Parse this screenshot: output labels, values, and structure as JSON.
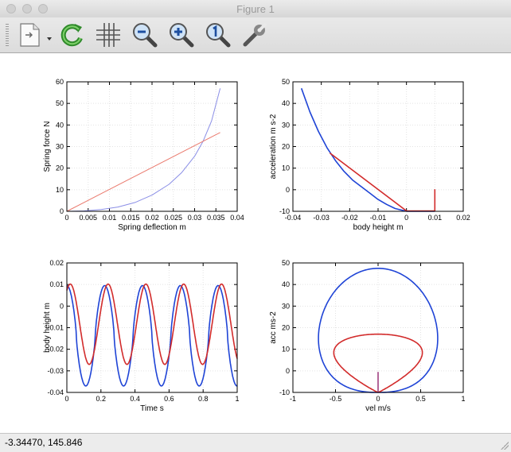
{
  "window": {
    "title": "Figure 1"
  },
  "toolbar": {
    "buttons": [
      {
        "name": "new-document-icon"
      },
      {
        "name": "refresh-icon"
      },
      {
        "name": "grid-icon"
      },
      {
        "name": "zoom-out-icon"
      },
      {
        "name": "zoom-in-icon"
      },
      {
        "name": "zoom-reset-icon"
      },
      {
        "name": "wrench-icon"
      }
    ]
  },
  "status": {
    "coords": "-3.34470,  145.846"
  },
  "colors": {
    "blue": "#1f44d6",
    "red": "#d22b2b",
    "lightblue": "#8a8ee6",
    "lightred": "#ea7a6e"
  },
  "chart_data": [
    {
      "type": "line",
      "title": "",
      "xlabel": "Spring deflection m",
      "ylabel": "Spring force N",
      "xlim": [
        0,
        0.04
      ],
      "ylim": [
        0,
        60
      ],
      "xticks": [
        "0",
        "0.005",
        "0.01",
        "0.015",
        "0.02",
        "0.025",
        "0.03",
        "0.035",
        "0.04"
      ],
      "yticks": [
        "0",
        "10",
        "20",
        "30",
        "40",
        "50",
        "60"
      ],
      "series": [
        {
          "color": "#8a8ee6",
          "kind": "progressive",
          "x": [
            0,
            0.004,
            0.008,
            0.012,
            0.016,
            0.02,
            0.024,
            0.027,
            0.03,
            0.032,
            0.034,
            0.036
          ],
          "y": [
            0,
            0.2,
            0.8,
            2.0,
            4.1,
            7.5,
            12.5,
            18.0,
            25.5,
            32.5,
            42.0,
            57.0
          ]
        },
        {
          "color": "#ea7a6e",
          "kind": "linear",
          "x": [
            0,
            0.036
          ],
          "y": [
            0,
            36.5
          ]
        }
      ]
    },
    {
      "type": "line",
      "title": "",
      "xlabel": "body height m",
      "ylabel": "acceleration m s-2",
      "xlim": [
        -0.04,
        0.02
      ],
      "ylim": [
        -10,
        50
      ],
      "xticks": [
        "-0.04",
        "-0.03",
        "-0.02",
        "-0.01",
        "0",
        "0.01",
        "0.02"
      ],
      "yticks": [
        "-10",
        "0",
        "10",
        "20",
        "30",
        "40",
        "50"
      ],
      "series": [
        {
          "color": "#1f44d6",
          "kind": "progressive",
          "x": [
            -0.037,
            -0.034,
            -0.031,
            -0.028,
            -0.025,
            -0.022,
            -0.019,
            -0.016,
            -0.013,
            -0.01,
            -0.007,
            -0.004,
            0,
            0.01
          ],
          "y": [
            47,
            36,
            27,
            19.5,
            13.5,
            8.5,
            4.5,
            1.5,
            -1.5,
            -4.5,
            -6.8,
            -8.7,
            -10,
            -10
          ]
        },
        {
          "color": "#d22b2b",
          "kind": "linear",
          "x": [
            -0.027,
            0,
            0.01,
            0.01,
            0.01
          ],
          "y": [
            17,
            -9.8,
            -9.8,
            0,
            -9.8
          ]
        }
      ]
    },
    {
      "type": "line",
      "title": "",
      "xlabel": "Time s",
      "ylabel": "body height m",
      "xlim": [
        0,
        1
      ],
      "ylim": [
        -0.04,
        0.02
      ],
      "xticks": [
        "0",
        "0.2",
        "0.4",
        "0.6",
        "0.8",
        "1"
      ],
      "yticks": [
        "-0.04",
        "-0.03",
        "-0.02",
        "-0.01",
        "0",
        "0.01",
        "0.02"
      ],
      "series": [
        {
          "color": "#1f44d6",
          "kind": "progressive",
          "period": 0.222,
          "peak": 0.0095,
          "trough": -0.037
        },
        {
          "color": "#d22b2b",
          "kind": "linear",
          "period": 0.222,
          "peak": 0.0102,
          "trough": -0.027,
          "lag": 0.02
        }
      ]
    },
    {
      "type": "line",
      "title": "",
      "xlabel": "vel m/s",
      "ylabel": "acc ms-2",
      "xlim": [
        -1,
        1
      ],
      "ylim": [
        -10,
        50
      ],
      "xticks": [
        "-1",
        "-0.5",
        "0",
        "0.5",
        "1"
      ],
      "yticks": [
        "-10",
        "0",
        "10",
        "20",
        "30",
        "40",
        "50"
      ],
      "series": [
        {
          "color": "#1f44d6",
          "kind": "progressive",
          "vmax": 0.7,
          "amax": 47.5,
          "amin": -10
        },
        {
          "color": "#d22b2b",
          "kind": "linear",
          "vmax": 0.52,
          "amax": 17,
          "amin": -10
        },
        {
          "color": "#a04080",
          "kind": "spike",
          "x": [
            0,
            0
          ],
          "y": [
            -10,
            -0.5
          ]
        }
      ]
    }
  ]
}
